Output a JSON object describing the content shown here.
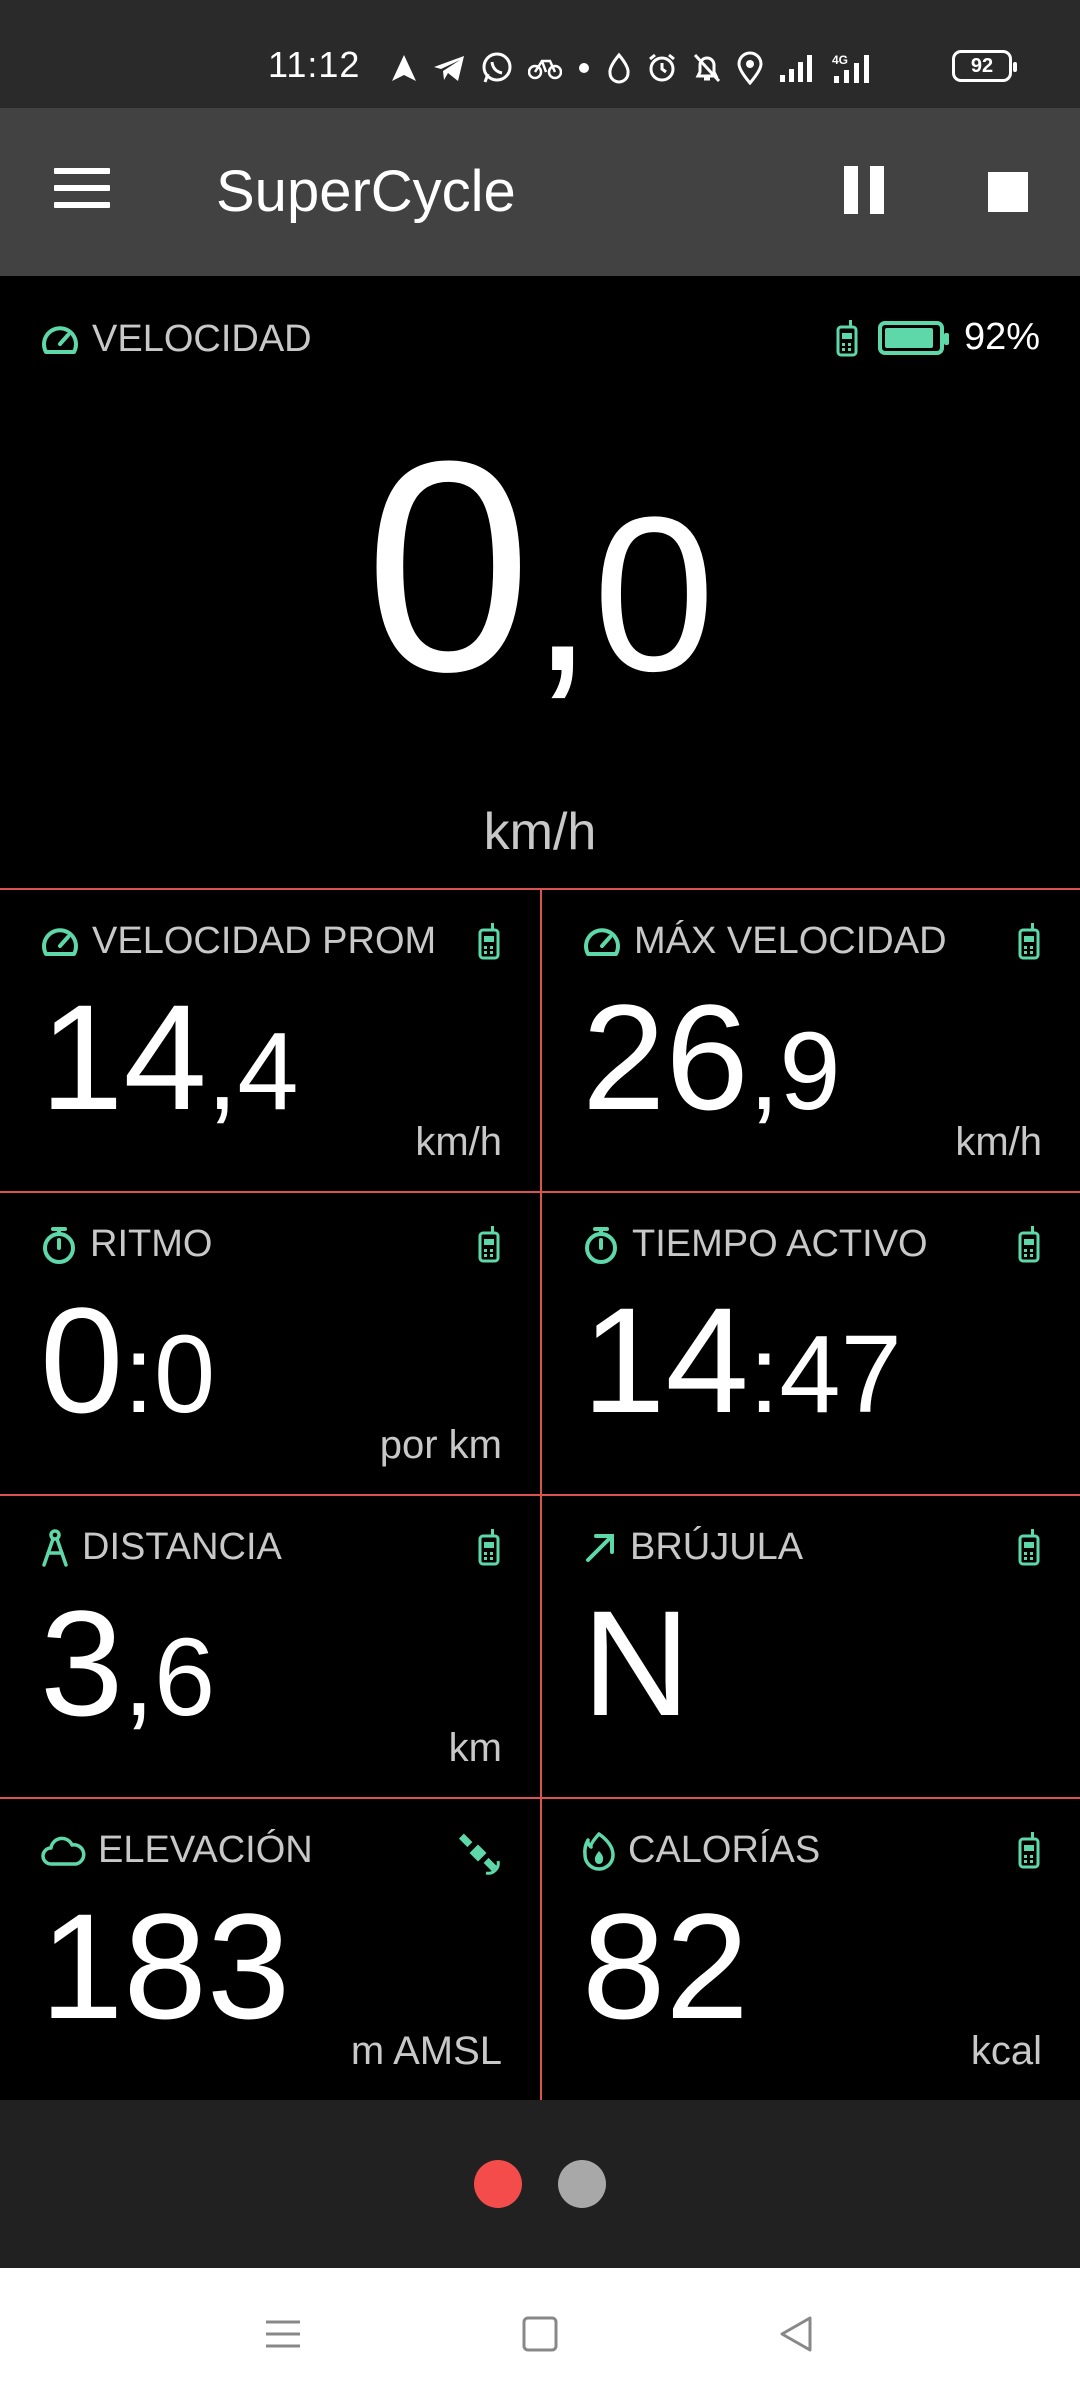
{
  "status_bar": {
    "time": "11:12",
    "battery": "92",
    "icons": [
      "navigation-icon",
      "telegram-icon",
      "whatsapp-icon",
      "bike-icon",
      "dot-icon",
      "drop-icon",
      "alarm-icon",
      "bell-off-icon",
      "location-icon",
      "signal-icon",
      "signal-4g-icon",
      "battery-icon"
    ]
  },
  "app_bar": {
    "title": "SuperCycle",
    "icons": [
      "menu-icon",
      "pause-icon",
      "stop-icon"
    ]
  },
  "speed": {
    "label": "VELOCIDAD",
    "value_int": "0",
    "value_dec": ",0",
    "unit": "km/h",
    "battery_pct": "92%",
    "battery_level": 0.92
  },
  "tiles": [
    {
      "label": "VELOCIDAD PROM",
      "icon": "speedometer-icon",
      "source": "phone-icon",
      "int": "14",
      "dec": ",4",
      "unit": "km/h"
    },
    {
      "label": "MÁX VELOCIDAD",
      "icon": "speedometer-icon",
      "source": "phone-icon",
      "int": "26",
      "dec": ",9",
      "unit": "km/h"
    },
    {
      "label": "RITMO",
      "icon": "stopwatch-icon",
      "source": "phone-icon",
      "int": "0",
      "dec": ":0",
      "unit": "por km"
    },
    {
      "label": "TIEMPO ACTIVO",
      "icon": "stopwatch-icon",
      "source": "phone-icon",
      "int": "14",
      "dec": ":47",
      "unit": ""
    },
    {
      "label": "DISTANCIA",
      "icon": "compass-drawing-icon",
      "source": "phone-icon",
      "int": "3",
      "dec": ",6",
      "unit": "km"
    },
    {
      "label": "BRÚJULA",
      "icon": "arrow-up-right-icon",
      "source": "phone-icon",
      "int": "N",
      "dec": "",
      "unit": ""
    },
    {
      "label": "ELEVACIÓN",
      "icon": "cloud-icon",
      "source": "satellite-icon",
      "int": "183",
      "dec": "",
      "unit": "m AMSL"
    },
    {
      "label": "CALORÍAS",
      "icon": "flame-icon",
      "source": "phone-icon",
      "int": "82",
      "dec": "",
      "unit": "kcal"
    }
  ],
  "pager": {
    "pages": 2,
    "active": 1
  },
  "colors": {
    "accent": "#5ed8a8",
    "divider": "#d9534f",
    "pager_active": "#f44b4b",
    "pager_inactive": "#a8a8a8",
    "app_bar": "#424242",
    "status_bar": "#2a2a2a"
  }
}
